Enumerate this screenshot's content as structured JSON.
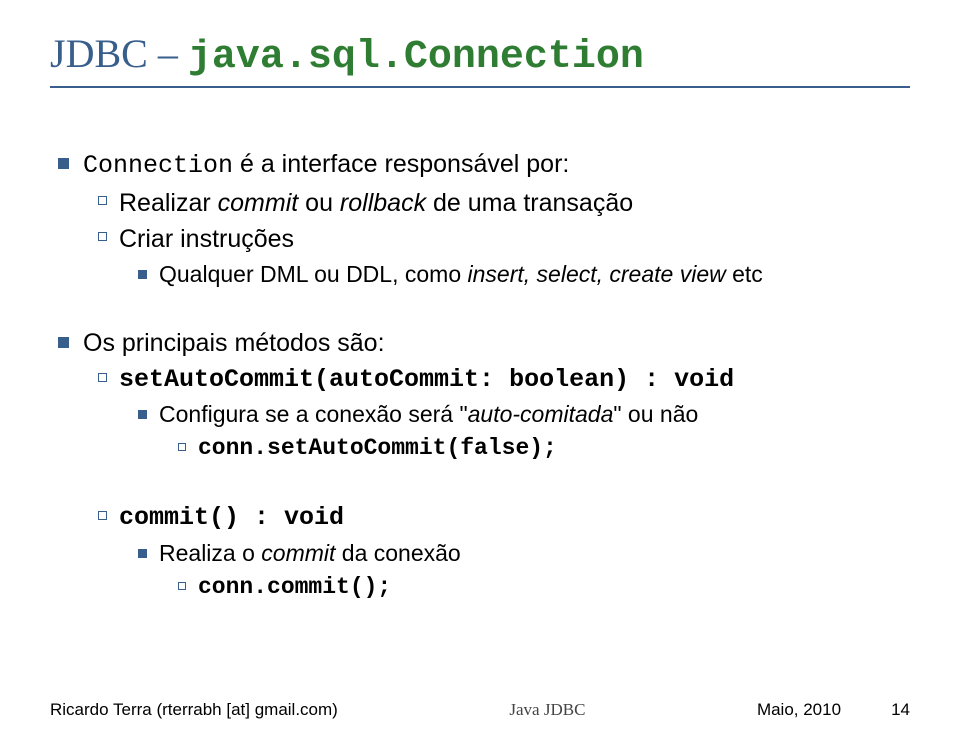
{
  "title": {
    "jdbc": "JDBC",
    "sep": " – ",
    "code": "java.sql.Connection"
  },
  "block1": {
    "heading_prefix": "Connection",
    "heading_rest": " é a interface responsável por:",
    "sub1_pre": "Realizar ",
    "sub1_i1": "commit",
    "sub1_mid": " ou ",
    "sub1_i2": "rollback",
    "sub1_post": " de uma transação",
    "sub2": "Criar instruções",
    "sub2a_pre": "Qualquer DML ou DDL, como ",
    "sub2a_i": "insert, select, create view",
    "sub2a_post": " etc"
  },
  "block2": {
    "heading": "Os principais métodos são:",
    "m1_sig": "setAutoCommit(autoCommit: boolean) : void",
    "m1_desc_pre": "Configura se a conexão será \"",
    "m1_desc_i": "auto-comitada",
    "m1_desc_post": "\" ou não",
    "m1_code": "conn.setAutoCommit(false);",
    "m2_sig": "commit() : void",
    "m2_desc_pre": "Realiza o ",
    "m2_desc_i": "commit",
    "m2_desc_post": " da conexão",
    "m2_code": "conn.commit();"
  },
  "footer": {
    "left": "Ricardo Terra (rterrabh [at] gmail.com)",
    "center": "Java JDBC",
    "date": "Maio, 2010",
    "page": "14"
  }
}
